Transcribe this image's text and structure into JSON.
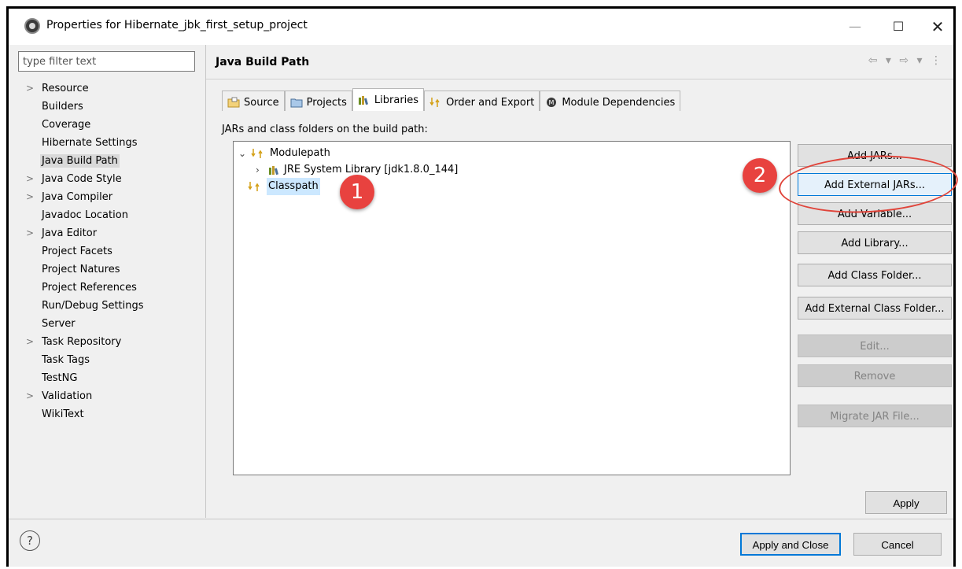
{
  "window": {
    "title": "Properties for Hibernate_jbk_first_setup_project",
    "controls": {
      "minimize": "—",
      "maximize": "☐",
      "close": "✕"
    }
  },
  "sidebar": {
    "filter_placeholder": "type filter text",
    "items": [
      {
        "label": "Resource",
        "expandable": true
      },
      {
        "label": "Builders",
        "expandable": false
      },
      {
        "label": "Coverage",
        "expandable": false
      },
      {
        "label": "Hibernate Settings",
        "expandable": false
      },
      {
        "label": "Java Build Path",
        "expandable": false,
        "selected": true
      },
      {
        "label": "Java Code Style",
        "expandable": true
      },
      {
        "label": "Java Compiler",
        "expandable": true
      },
      {
        "label": "Javadoc Location",
        "expandable": false
      },
      {
        "label": "Java Editor",
        "expandable": true
      },
      {
        "label": "Project Facets",
        "expandable": false
      },
      {
        "label": "Project Natures",
        "expandable": false
      },
      {
        "label": "Project References",
        "expandable": false
      },
      {
        "label": "Run/Debug Settings",
        "expandable": false
      },
      {
        "label": "Server",
        "expandable": false
      },
      {
        "label": "Task Repository",
        "expandable": true
      },
      {
        "label": "Task Tags",
        "expandable": false
      },
      {
        "label": "TestNG",
        "expandable": false
      },
      {
        "label": "Validation",
        "expandable": true
      },
      {
        "label": "WikiText",
        "expandable": false
      }
    ]
  },
  "page": {
    "title": "Java Build Path",
    "nav": "⇦ ▾ ⇨ ▾ ⋮",
    "tabs": [
      {
        "label": "Source",
        "icon": "source-folder-icon"
      },
      {
        "label": "Projects",
        "icon": "projects-folder-icon"
      },
      {
        "label": "Libraries",
        "icon": "libraries-icon",
        "active": true
      },
      {
        "label": "Order and Export",
        "icon": "order-export-icon"
      },
      {
        "label": "Module Dependencies",
        "icon": "module-icon"
      }
    ],
    "list_label": "JARs and class folders on the build path:",
    "tree": {
      "modulepath": "Modulepath",
      "jre": "JRE System Library [jdk1.8.0_144]",
      "classpath": "Classpath"
    },
    "buttons": [
      {
        "label": "Add JARs...",
        "state": "normal"
      },
      {
        "label": "Add External JARs...",
        "state": "focused"
      },
      {
        "label": "Add Variable...",
        "state": "normal"
      },
      {
        "label": "Add Library...",
        "state": "normal"
      },
      {
        "label": "Add Class Folder...",
        "state": "normal"
      },
      {
        "label": "Add External Class Folder...",
        "state": "normal"
      },
      {
        "label": "Edit...",
        "state": "disabled"
      },
      {
        "label": "Remove",
        "state": "disabled"
      },
      {
        "label": "Migrate JAR File...",
        "state": "disabled"
      }
    ],
    "apply": "Apply"
  },
  "footer": {
    "help": "?",
    "apply_close": "Apply and Close",
    "cancel": "Cancel"
  },
  "annotations": {
    "callout_1": "1",
    "callout_2": "2",
    "color": "#e8423f"
  }
}
